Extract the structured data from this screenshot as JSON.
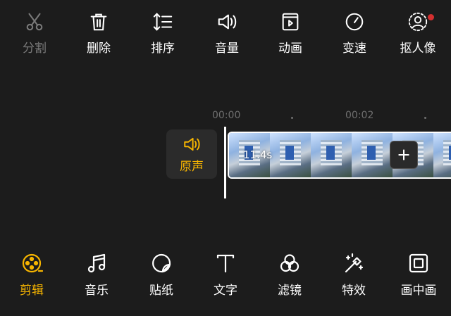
{
  "top_toolbar": {
    "items": [
      {
        "label": "分割",
        "icon": "scissors-icon",
        "disabled": true
      },
      {
        "label": "删除",
        "icon": "trash-icon"
      },
      {
        "label": "排序",
        "icon": "sort-icon"
      },
      {
        "label": "音量",
        "icon": "volume-icon"
      },
      {
        "label": "动画",
        "icon": "animation-icon"
      },
      {
        "label": "变速",
        "icon": "speed-icon"
      },
      {
        "label": "抠人像",
        "icon": "portrait-cutout-icon",
        "badge": true
      }
    ]
  },
  "timeline": {
    "ruler": {
      "start": "00:00",
      "mid": "00:02"
    },
    "audio_toggle_label": "原声",
    "clip": {
      "duration": "11.4s"
    }
  },
  "bottom_toolbar": {
    "items": [
      {
        "label": "剪辑",
        "icon": "edit-reel-icon",
        "active": true
      },
      {
        "label": "音乐",
        "icon": "music-icon"
      },
      {
        "label": "贴纸",
        "icon": "sticker-icon"
      },
      {
        "label": "文字",
        "icon": "text-icon"
      },
      {
        "label": "滤镜",
        "icon": "filter-icon"
      },
      {
        "label": "特效",
        "icon": "effects-icon"
      },
      {
        "label": "画中画",
        "icon": "picture-in-picture-icon"
      }
    ]
  },
  "colors": {
    "accent": "#f7b500",
    "background": "#1c1c1c",
    "badge": "#d32f2f"
  }
}
